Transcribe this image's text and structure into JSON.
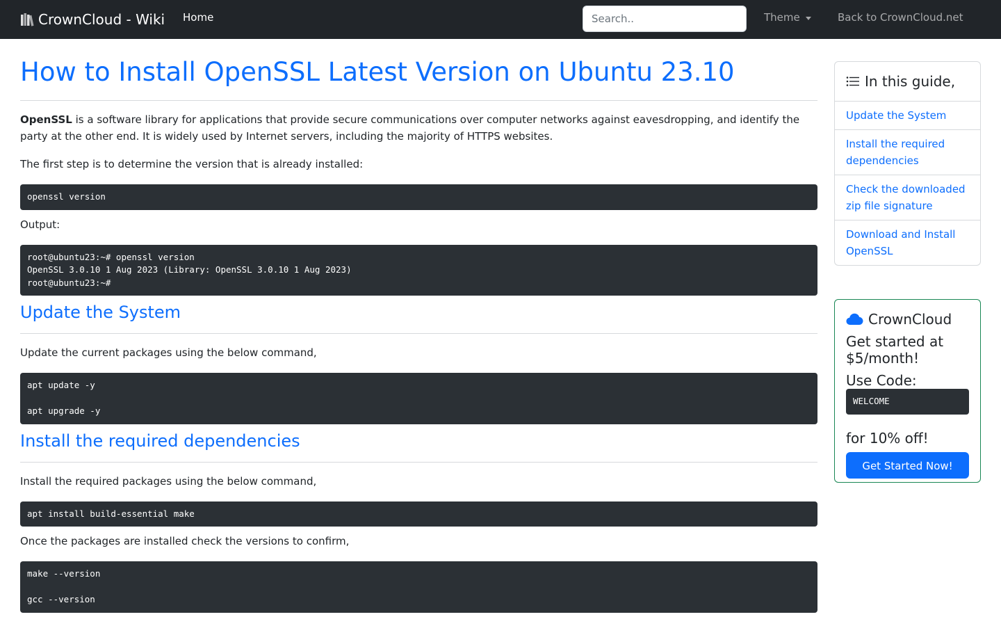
{
  "navbar": {
    "brand": "CrownCloud - Wiki",
    "home": "Home",
    "search_placeholder": "Search..",
    "theme": "Theme",
    "back": "Back to CrownCloud.net"
  },
  "article": {
    "title": "How to Install OpenSSL Latest Version on Ubuntu 23.10",
    "intro_bold": "OpenSSL",
    "intro_rest": " is a software library for applications that provide secure communications over computer networks against eavesdropping, and identify the party at the other end. It is widely used by Internet servers, including the majority of HTTPS websites.",
    "step1_text": "The first step is to determine the version that is already installed:",
    "code1": "openssl version",
    "output_label": "Output:",
    "code2": "root@ubuntu23:~# openssl version\nOpenSSL 3.0.10 1 Aug 2023 (Library: OpenSSL 3.0.10 1 Aug 2023)\nroot@ubuntu23:~#",
    "section1_title": "Update the System",
    "section1_text": "Update the current packages using the below command,",
    "code3": "apt update -y\n\napt upgrade -y",
    "section2_title": "Install the required dependencies",
    "section2_text": "Install the required packages using the below command,",
    "code4": "apt install build-essential make",
    "confirm_text": "Once the packages are installed check the versions to confirm,",
    "code5": "make --version\n\ngcc --version"
  },
  "toc": {
    "header": "In this guide,",
    "items": [
      "Update the System",
      "Install the required dependencies",
      "Check the downloaded zip file signature",
      "Download and Install OpenSSL"
    ]
  },
  "promo": {
    "brand": "CrownCloud",
    "line1": "Get started at $5/month!",
    "line2": "Use Code:",
    "code": "WELCOME",
    "line3": "for 10% off!",
    "button": "Get Started Now!"
  },
  "colors": {
    "navbar_bg": "#212529",
    "link": "#0d6efd",
    "code_bg": "#2b3035",
    "promo_border": "#198754"
  }
}
